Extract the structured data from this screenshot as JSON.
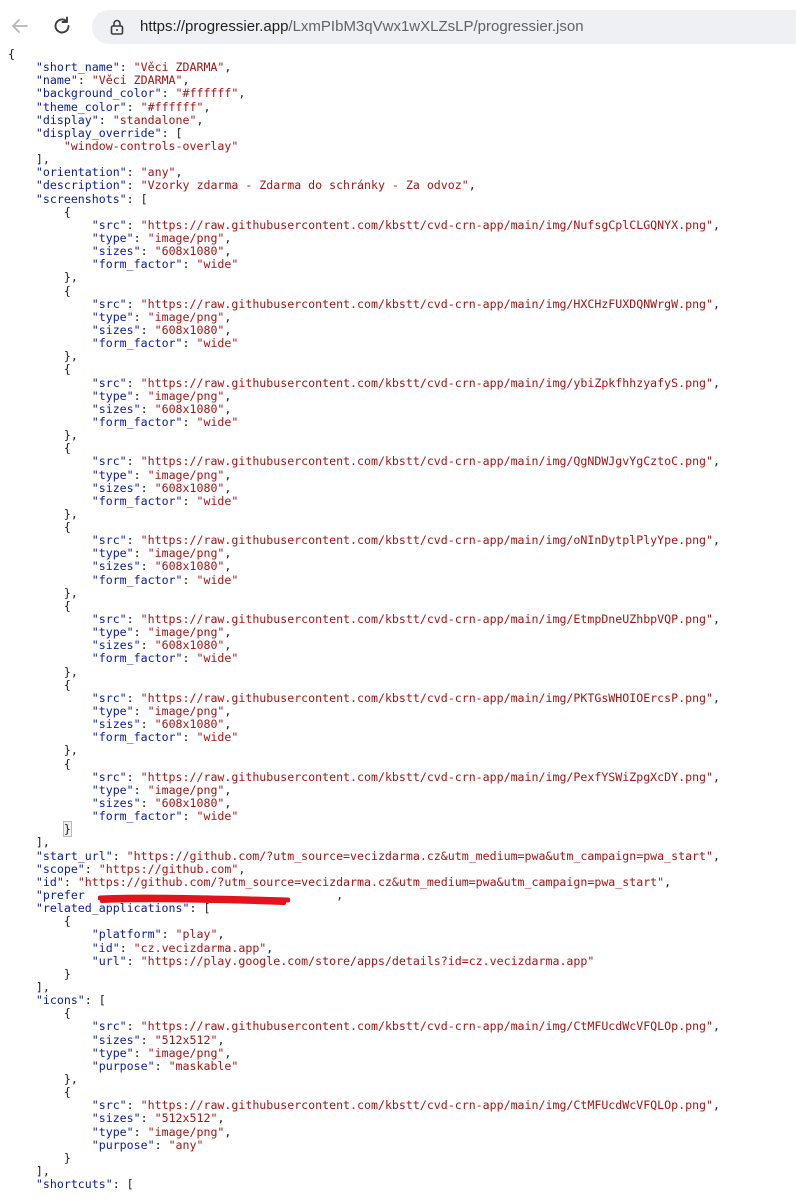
{
  "browser": {
    "url_host": "https://progressier.app",
    "url_path": "/LxmPIbM3qVwx1wXLZsLP/progressier.json",
    "back_icon": "arrow-left-icon",
    "reload_icon": "reload-icon",
    "site_info_icon": "lock-icon"
  },
  "colors": {
    "key": "#0b1b99",
    "string": "#a31515",
    "punct": "#1a1a1a",
    "scribble": "#e4121a"
  },
  "annotations": {
    "redaction_scribble": "red-underline-scribble"
  },
  "json_lines": [
    [
      [
        "p",
        "{"
      ]
    ],
    [
      [
        "p",
        "    "
      ],
      [
        "k",
        "\"short_name\""
      ],
      [
        "p",
        ": "
      ],
      [
        "s",
        "\"Věci ZDARMA\""
      ],
      [
        "p",
        ","
      ]
    ],
    [
      [
        "p",
        "    "
      ],
      [
        "k",
        "\"name\""
      ],
      [
        "p",
        ": "
      ],
      [
        "s",
        "\"Věci ZDARMA\""
      ],
      [
        "p",
        ","
      ]
    ],
    [
      [
        "p",
        "    "
      ],
      [
        "k",
        "\"background_color\""
      ],
      [
        "p",
        ": "
      ],
      [
        "s",
        "\"#ffffff\""
      ],
      [
        "p",
        ","
      ]
    ],
    [
      [
        "p",
        "    "
      ],
      [
        "k",
        "\"theme_color\""
      ],
      [
        "p",
        ": "
      ],
      [
        "s",
        "\"#ffffff\""
      ],
      [
        "p",
        ","
      ]
    ],
    [
      [
        "p",
        "    "
      ],
      [
        "k",
        "\"display\""
      ],
      [
        "p",
        ": "
      ],
      [
        "s",
        "\"standalone\""
      ],
      [
        "p",
        ","
      ]
    ],
    [
      [
        "p",
        "    "
      ],
      [
        "k",
        "\"display_override\""
      ],
      [
        "p",
        ": ["
      ]
    ],
    [
      [
        "p",
        "        "
      ],
      [
        "s",
        "\"window-controls-overlay\""
      ]
    ],
    [
      [
        "p",
        "    ],"
      ]
    ],
    [
      [
        "p",
        "    "
      ],
      [
        "k",
        "\"orientation\""
      ],
      [
        "p",
        ": "
      ],
      [
        "s",
        "\"any\""
      ],
      [
        "p",
        ","
      ]
    ],
    [
      [
        "p",
        "    "
      ],
      [
        "k",
        "\"description\""
      ],
      [
        "p",
        ": "
      ],
      [
        "s",
        "\"Vzorky zdarma - Zdarma do schránky - Za odvoz\""
      ],
      [
        "p",
        ","
      ]
    ],
    [
      [
        "p",
        "    "
      ],
      [
        "k",
        "\"screenshots\""
      ],
      [
        "p",
        ": ["
      ]
    ],
    [
      [
        "p",
        "        {"
      ]
    ],
    [
      [
        "p",
        "            "
      ],
      [
        "k",
        "\"src\""
      ],
      [
        "p",
        ": "
      ],
      [
        "s",
        "\"https://raw.githubusercontent.com/kbstt/cvd-crn-app/main/img/NufsgCplCLGQNYX.png\""
      ],
      [
        "p",
        ","
      ]
    ],
    [
      [
        "p",
        "            "
      ],
      [
        "k",
        "\"type\""
      ],
      [
        "p",
        ": "
      ],
      [
        "s",
        "\"image/png\""
      ],
      [
        "p",
        ","
      ]
    ],
    [
      [
        "p",
        "            "
      ],
      [
        "k",
        "\"sizes\""
      ],
      [
        "p",
        ": "
      ],
      [
        "s",
        "\"608x1080\""
      ],
      [
        "p",
        ","
      ]
    ],
    [
      [
        "p",
        "            "
      ],
      [
        "k",
        "\"form_factor\""
      ],
      [
        "p",
        ": "
      ],
      [
        "s",
        "\"wide\""
      ]
    ],
    [
      [
        "p",
        "        },"
      ]
    ],
    [
      [
        "p",
        "        {"
      ]
    ],
    [
      [
        "p",
        "            "
      ],
      [
        "k",
        "\"src\""
      ],
      [
        "p",
        ": "
      ],
      [
        "s",
        "\"https://raw.githubusercontent.com/kbstt/cvd-crn-app/main/img/HXCHzFUXDQNWrgW.png\""
      ],
      [
        "p",
        ","
      ]
    ],
    [
      [
        "p",
        "            "
      ],
      [
        "k",
        "\"type\""
      ],
      [
        "p",
        ": "
      ],
      [
        "s",
        "\"image/png\""
      ],
      [
        "p",
        ","
      ]
    ],
    [
      [
        "p",
        "            "
      ],
      [
        "k",
        "\"sizes\""
      ],
      [
        "p",
        ": "
      ],
      [
        "s",
        "\"608x1080\""
      ],
      [
        "p",
        ","
      ]
    ],
    [
      [
        "p",
        "            "
      ],
      [
        "k",
        "\"form_factor\""
      ],
      [
        "p",
        ": "
      ],
      [
        "s",
        "\"wide\""
      ]
    ],
    [
      [
        "p",
        "        },"
      ]
    ],
    [
      [
        "p",
        "        {"
      ]
    ],
    [
      [
        "p",
        "            "
      ],
      [
        "k",
        "\"src\""
      ],
      [
        "p",
        ": "
      ],
      [
        "s",
        "\"https://raw.githubusercontent.com/kbstt/cvd-crn-app/main/img/ybiZpkfhhzyafyS.png\""
      ],
      [
        "p",
        ","
      ]
    ],
    [
      [
        "p",
        "            "
      ],
      [
        "k",
        "\"type\""
      ],
      [
        "p",
        ": "
      ],
      [
        "s",
        "\"image/png\""
      ],
      [
        "p",
        ","
      ]
    ],
    [
      [
        "p",
        "            "
      ],
      [
        "k",
        "\"sizes\""
      ],
      [
        "p",
        ": "
      ],
      [
        "s",
        "\"608x1080\""
      ],
      [
        "p",
        ","
      ]
    ],
    [
      [
        "p",
        "            "
      ],
      [
        "k",
        "\"form_factor\""
      ],
      [
        "p",
        ": "
      ],
      [
        "s",
        "\"wide\""
      ]
    ],
    [
      [
        "p",
        "        },"
      ]
    ],
    [
      [
        "p",
        "        {"
      ]
    ],
    [
      [
        "p",
        "            "
      ],
      [
        "k",
        "\"src\""
      ],
      [
        "p",
        ": "
      ],
      [
        "s",
        "\"https://raw.githubusercontent.com/kbstt/cvd-crn-app/main/img/QgNDWJgvYgCztoC.png\""
      ],
      [
        "p",
        ","
      ]
    ],
    [
      [
        "p",
        "            "
      ],
      [
        "k",
        "\"type\""
      ],
      [
        "p",
        ": "
      ],
      [
        "s",
        "\"image/png\""
      ],
      [
        "p",
        ","
      ]
    ],
    [
      [
        "p",
        "            "
      ],
      [
        "k",
        "\"sizes\""
      ],
      [
        "p",
        ": "
      ],
      [
        "s",
        "\"608x1080\""
      ],
      [
        "p",
        ","
      ]
    ],
    [
      [
        "p",
        "            "
      ],
      [
        "k",
        "\"form_factor\""
      ],
      [
        "p",
        ": "
      ],
      [
        "s",
        "\"wide\""
      ]
    ],
    [
      [
        "p",
        "        },"
      ]
    ],
    [
      [
        "p",
        "        {"
      ]
    ],
    [
      [
        "p",
        "            "
      ],
      [
        "k",
        "\"src\""
      ],
      [
        "p",
        ": "
      ],
      [
        "s",
        "\"https://raw.githubusercontent.com/kbstt/cvd-crn-app/main/img/oNInDytplPlyYpe.png\""
      ],
      [
        "p",
        ","
      ]
    ],
    [
      [
        "p",
        "            "
      ],
      [
        "k",
        "\"type\""
      ],
      [
        "p",
        ": "
      ],
      [
        "s",
        "\"image/png\""
      ],
      [
        "p",
        ","
      ]
    ],
    [
      [
        "p",
        "            "
      ],
      [
        "k",
        "\"sizes\""
      ],
      [
        "p",
        ": "
      ],
      [
        "s",
        "\"608x1080\""
      ],
      [
        "p",
        ","
      ]
    ],
    [
      [
        "p",
        "            "
      ],
      [
        "k",
        "\"form_factor\""
      ],
      [
        "p",
        ": "
      ],
      [
        "s",
        "\"wide\""
      ]
    ],
    [
      [
        "p",
        "        },"
      ]
    ],
    [
      [
        "p",
        "        {"
      ]
    ],
    [
      [
        "p",
        "            "
      ],
      [
        "k",
        "\"src\""
      ],
      [
        "p",
        ": "
      ],
      [
        "s",
        "\"https://raw.githubusercontent.com/kbstt/cvd-crn-app/main/img/EtmpDneUZhbpVQP.png\""
      ],
      [
        "p",
        ","
      ]
    ],
    [
      [
        "p",
        "            "
      ],
      [
        "k",
        "\"type\""
      ],
      [
        "p",
        ": "
      ],
      [
        "s",
        "\"image/png\""
      ],
      [
        "p",
        ","
      ]
    ],
    [
      [
        "p",
        "            "
      ],
      [
        "k",
        "\"sizes\""
      ],
      [
        "p",
        ": "
      ],
      [
        "s",
        "\"608x1080\""
      ],
      [
        "p",
        ","
      ]
    ],
    [
      [
        "p",
        "            "
      ],
      [
        "k",
        "\"form_factor\""
      ],
      [
        "p",
        ": "
      ],
      [
        "s",
        "\"wide\""
      ]
    ],
    [
      [
        "p",
        "        },"
      ]
    ],
    [
      [
        "p",
        "        {"
      ]
    ],
    [
      [
        "p",
        "            "
      ],
      [
        "k",
        "\"src\""
      ],
      [
        "p",
        ": "
      ],
      [
        "s",
        "\"https://raw.githubusercontent.com/kbstt/cvd-crn-app/main/img/PKTGsWHOIOErcsP.png\""
      ],
      [
        "p",
        ","
      ]
    ],
    [
      [
        "p",
        "            "
      ],
      [
        "k",
        "\"type\""
      ],
      [
        "p",
        ": "
      ],
      [
        "s",
        "\"image/png\""
      ],
      [
        "p",
        ","
      ]
    ],
    [
      [
        "p",
        "            "
      ],
      [
        "k",
        "\"sizes\""
      ],
      [
        "p",
        ": "
      ],
      [
        "s",
        "\"608x1080\""
      ],
      [
        "p",
        ","
      ]
    ],
    [
      [
        "p",
        "            "
      ],
      [
        "k",
        "\"form_factor\""
      ],
      [
        "p",
        ": "
      ],
      [
        "s",
        "\"wide\""
      ]
    ],
    [
      [
        "p",
        "        },"
      ]
    ],
    [
      [
        "p",
        "        {"
      ]
    ],
    [
      [
        "p",
        "            "
      ],
      [
        "k",
        "\"src\""
      ],
      [
        "p",
        ": "
      ],
      [
        "s",
        "\"https://raw.githubusercontent.com/kbstt/cvd-crn-app/main/img/PexfYSWiZpgXcDY.png\""
      ],
      [
        "p",
        ","
      ]
    ],
    [
      [
        "p",
        "            "
      ],
      [
        "k",
        "\"type\""
      ],
      [
        "p",
        ": "
      ],
      [
        "s",
        "\"image/png\""
      ],
      [
        "p",
        ","
      ]
    ],
    [
      [
        "p",
        "            "
      ],
      [
        "k",
        "\"sizes\""
      ],
      [
        "p",
        ": "
      ],
      [
        "s",
        "\"608x1080\""
      ],
      [
        "p",
        ","
      ]
    ],
    [
      [
        "p",
        "            "
      ],
      [
        "k",
        "\"form_factor\""
      ],
      [
        "p",
        ": "
      ],
      [
        "s",
        "\"wide\""
      ]
    ],
    [
      [
        "p",
        "        "
      ],
      [
        "b",
        "}"
      ]
    ],
    [
      [
        "p",
        "    ],"
      ]
    ],
    [
      [
        "p",
        "    "
      ],
      [
        "k",
        "\"start_url\""
      ],
      [
        "p",
        ": "
      ],
      [
        "s",
        "\"https://github.com/?utm_source=vecizdarma.cz&utm_medium=pwa&utm_campaign=pwa_start\""
      ],
      [
        "p",
        ","
      ]
    ],
    [
      [
        "p",
        "    "
      ],
      [
        "k",
        "\"scope\""
      ],
      [
        "p",
        ": "
      ],
      [
        "s",
        "\"https://github.com\""
      ],
      [
        "p",
        ","
      ]
    ],
    [
      [
        "p",
        "    "
      ],
      [
        "k",
        "\"id\""
      ],
      [
        "p",
        ": "
      ],
      [
        "s",
        "\"https://github.com/?utm_source=vecizdarma.cz&utm_medium=pwa&utm_campaign=pwa_start\""
      ],
      [
        "p",
        ","
      ]
    ],
    [
      [
        "p",
        "    "
      ],
      [
        "k",
        "\"prefer"
      ],
      [
        "p",
        "                                    ,"
      ]
    ],
    [
      [
        "p",
        "    "
      ],
      [
        "k",
        "\"related_applications\""
      ],
      [
        "p",
        ": ["
      ]
    ],
    [
      [
        "p",
        "        {"
      ]
    ],
    [
      [
        "p",
        "            "
      ],
      [
        "k",
        "\"platform\""
      ],
      [
        "p",
        ": "
      ],
      [
        "s",
        "\"play\""
      ],
      [
        "p",
        ","
      ]
    ],
    [
      [
        "p",
        "            "
      ],
      [
        "k",
        "\"id\""
      ],
      [
        "p",
        ": "
      ],
      [
        "s",
        "\"cz.vecizdarma.app\""
      ],
      [
        "p",
        ","
      ]
    ],
    [
      [
        "p",
        "            "
      ],
      [
        "k",
        "\"url\""
      ],
      [
        "p",
        ": "
      ],
      [
        "s",
        "\"https://play.google.com/store/apps/details?id=cz.vecizdarma.app\""
      ]
    ],
    [
      [
        "p",
        "        }"
      ]
    ],
    [
      [
        "p",
        "    ],"
      ]
    ],
    [
      [
        "p",
        "    "
      ],
      [
        "k",
        "\"icons\""
      ],
      [
        "p",
        ": ["
      ]
    ],
    [
      [
        "p",
        "        {"
      ]
    ],
    [
      [
        "p",
        "            "
      ],
      [
        "k",
        "\"src\""
      ],
      [
        "p",
        ": "
      ],
      [
        "s",
        "\"https://raw.githubusercontent.com/kbstt/cvd-crn-app/main/img/CtMFUcdWcVFQLOp.png\""
      ],
      [
        "p",
        ","
      ]
    ],
    [
      [
        "p",
        "            "
      ],
      [
        "k",
        "\"sizes\""
      ],
      [
        "p",
        ": "
      ],
      [
        "s",
        "\"512x512\""
      ],
      [
        "p",
        ","
      ]
    ],
    [
      [
        "p",
        "            "
      ],
      [
        "k",
        "\"type\""
      ],
      [
        "p",
        ": "
      ],
      [
        "s",
        "\"image/png\""
      ],
      [
        "p",
        ","
      ]
    ],
    [
      [
        "p",
        "            "
      ],
      [
        "k",
        "\"purpose\""
      ],
      [
        "p",
        ": "
      ],
      [
        "s",
        "\"maskable\""
      ]
    ],
    [
      [
        "p",
        "        },"
      ]
    ],
    [
      [
        "p",
        "        {"
      ]
    ],
    [
      [
        "p",
        "            "
      ],
      [
        "k",
        "\"src\""
      ],
      [
        "p",
        ": "
      ],
      [
        "s",
        "\"https://raw.githubusercontent.com/kbstt/cvd-crn-app/main/img/CtMFUcdWcVFQLOp.png\""
      ],
      [
        "p",
        ","
      ]
    ],
    [
      [
        "p",
        "            "
      ],
      [
        "k",
        "\"sizes\""
      ],
      [
        "p",
        ": "
      ],
      [
        "s",
        "\"512x512\""
      ],
      [
        "p",
        ","
      ]
    ],
    [
      [
        "p",
        "            "
      ],
      [
        "k",
        "\"type\""
      ],
      [
        "p",
        ": "
      ],
      [
        "s",
        "\"image/png\""
      ],
      [
        "p",
        ","
      ]
    ],
    [
      [
        "p",
        "            "
      ],
      [
        "k",
        "\"purpose\""
      ],
      [
        "p",
        ": "
      ],
      [
        "s",
        "\"any\""
      ]
    ],
    [
      [
        "p",
        "        }"
      ]
    ],
    [
      [
        "p",
        "    ],"
      ]
    ],
    [
      [
        "p",
        "    "
      ],
      [
        "k",
        "\"shortcuts\""
      ],
      [
        "p",
        ": ["
      ]
    ]
  ]
}
